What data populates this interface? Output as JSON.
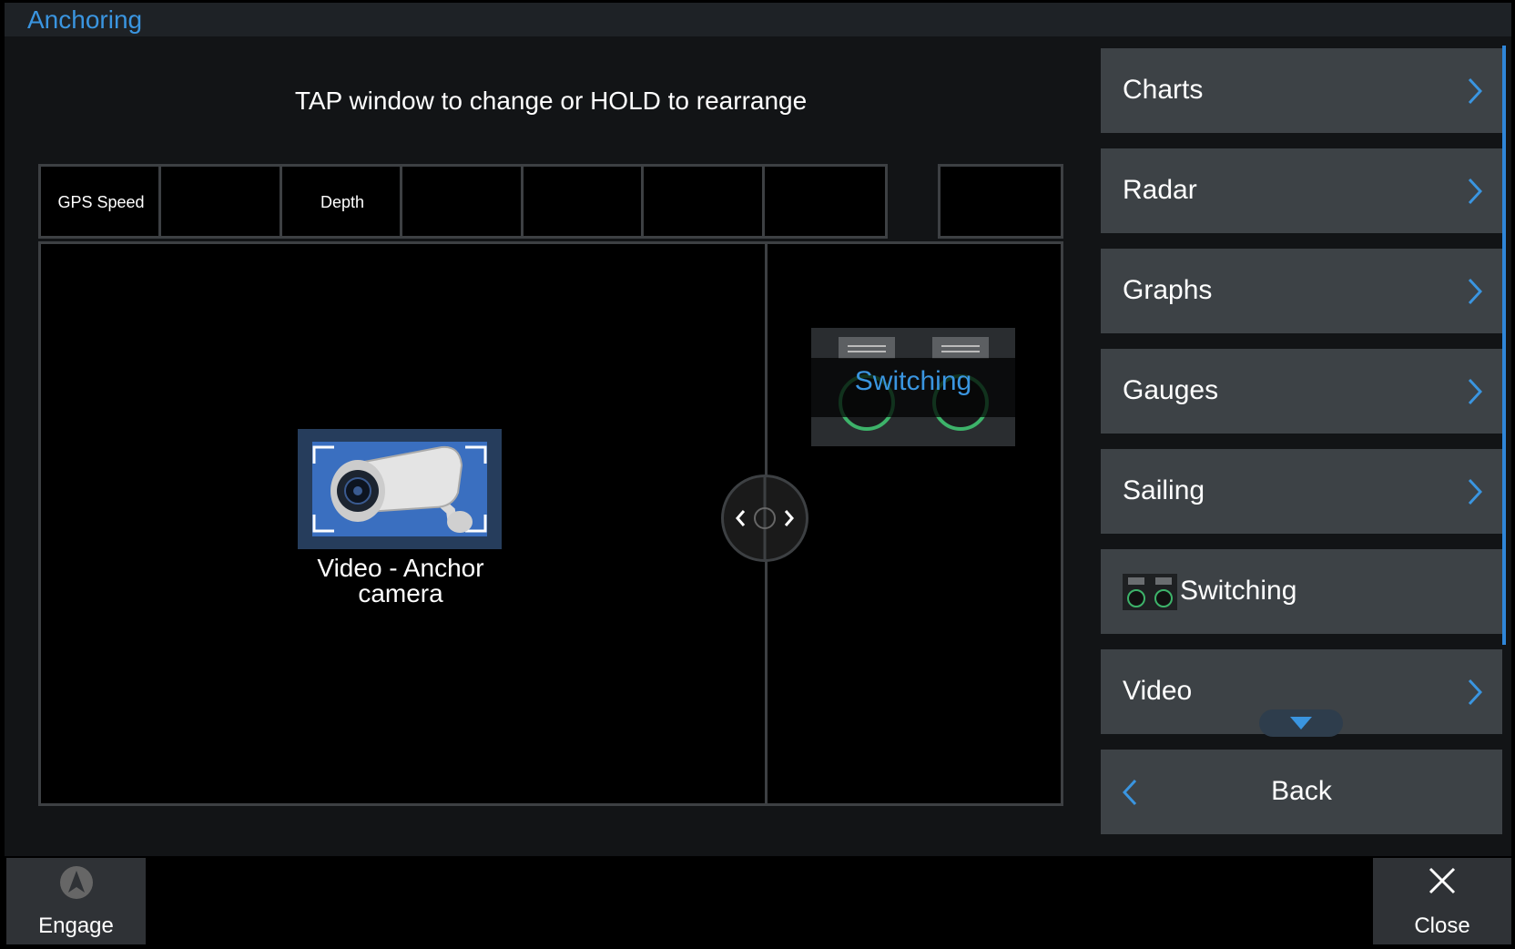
{
  "header": {
    "title": "Anchoring"
  },
  "instruction": "TAP window to change or HOLD to rearrange",
  "databar": [
    "GPS Speed",
    "",
    "Depth",
    "",
    "",
    "",
    "",
    ""
  ],
  "panes": {
    "left": {
      "label": "Video - Anchor\ncamera",
      "icon": "security-camera-icon"
    },
    "right": {
      "label": "Switching",
      "icon": "switching-icon"
    }
  },
  "menu": {
    "items": [
      {
        "label": "Charts",
        "has_submenu": true
      },
      {
        "label": "Radar",
        "has_submenu": true
      },
      {
        "label": "Graphs",
        "has_submenu": true
      },
      {
        "label": "Gauges",
        "has_submenu": true
      },
      {
        "label": "Sailing",
        "has_submenu": true
      },
      {
        "label": "Switching",
        "has_submenu": false,
        "icon": "switching-icon"
      },
      {
        "label": "Video",
        "has_submenu": true
      }
    ],
    "back_label": "Back"
  },
  "footer": {
    "engage_label": "Engage",
    "close_label": "Close"
  },
  "colors": {
    "accent": "#3a95e0",
    "panel": "#3d4246",
    "background": "#121416"
  }
}
